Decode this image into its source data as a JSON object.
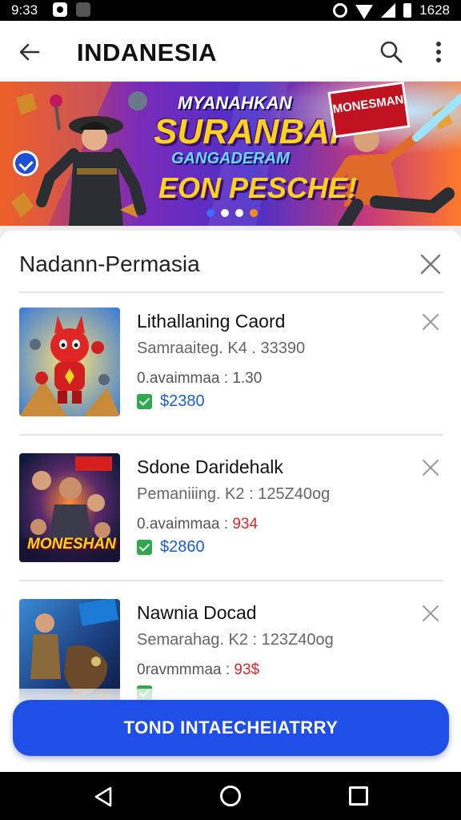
{
  "status_bar": {
    "time": "9:33",
    "right_text": "1628"
  },
  "app_bar": {
    "title": "INDANESIA",
    "back_icon": "arrow-left-icon",
    "search_icon": "search-icon",
    "more_icon": "more-vert-icon"
  },
  "banner": {
    "line1": "MYANAHKAN",
    "line2": "SURANBAI",
    "line3": "GANGADERAM",
    "line4": "EON PESCHE!",
    "sign_text": "MONESMAN",
    "dots": [
      "#3b6cff",
      "#ffffff",
      "#ffffff",
      "#ff8a1f"
    ]
  },
  "card": {
    "title": "Nadann-Permasia",
    "items": [
      {
        "name": "Lithallaning Caord",
        "sub": "Samraaiteg. K4 . 33390",
        "meta_label": "0.avaimmaa : ",
        "meta_value": "1.30",
        "price": "$2380",
        "thumb": "red-hero"
      },
      {
        "name": "Sdone Daridehalk",
        "sub": "Pemaniiing. K2 : 125Z40og",
        "meta_label": "0.avaimmaa : ",
        "meta_value": "934",
        "price": "$2860",
        "thumb": "moneshan"
      },
      {
        "name": "Nawnia Docad",
        "sub": "Semarahag. K2 : 123Z40og",
        "meta_label": "0ravmmmaa : ",
        "meta_value": "93$",
        "price": "",
        "thumb": "soldier"
      }
    ]
  },
  "cta": {
    "label": "TOND INTAECHEIATRRY"
  },
  "colors": {
    "primary": "#1f4fe6",
    "price": "#1c5bd6",
    "highlight": "#d42a2a",
    "check": "#2fa84f"
  }
}
